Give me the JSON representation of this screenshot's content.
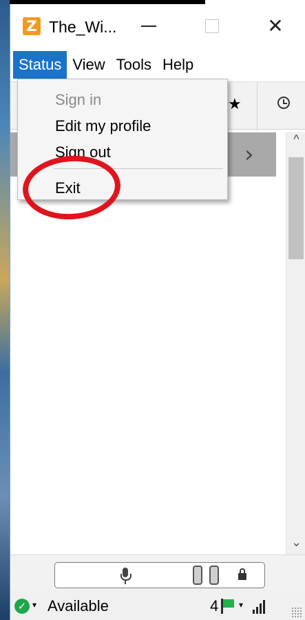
{
  "window": {
    "title": "The_Wi...",
    "logo_letter": "Z",
    "close_glyph": "✕"
  },
  "menubar": {
    "items": [
      "Status",
      "View",
      "Tools",
      "Help"
    ],
    "active": "Status"
  },
  "toolbar": {
    "star_glyph": "★"
  },
  "banner": {
    "chevron": "›"
  },
  "scroll": {
    "up": "^",
    "down": "⌄"
  },
  "dropdown": {
    "items": [
      {
        "label": "Sign in",
        "enabled": false
      },
      {
        "label": "Edit my profile",
        "enabled": true
      },
      {
        "label": "Sign out",
        "enabled": true
      },
      {
        "label": "Exit",
        "enabled": true
      }
    ]
  },
  "annotation": {
    "color": "#e0141c",
    "target": "Exit"
  },
  "statusbar": {
    "status": "Available",
    "check_glyph": "✓",
    "caret": "▾",
    "message_count": "4",
    "status_color": "#1fa64a"
  },
  "colors": {
    "menu_active": "#1a73c9",
    "logo": "#f39a1e",
    "flag": "#21b24b"
  },
  "icons": [
    "app-logo-icon",
    "minimize-icon",
    "maximize-icon",
    "close-icon",
    "star-icon",
    "clock-icon",
    "chevron-right-icon",
    "microphone-icon",
    "lock-icon",
    "check-icon",
    "flag-icon",
    "signal-icon"
  ]
}
